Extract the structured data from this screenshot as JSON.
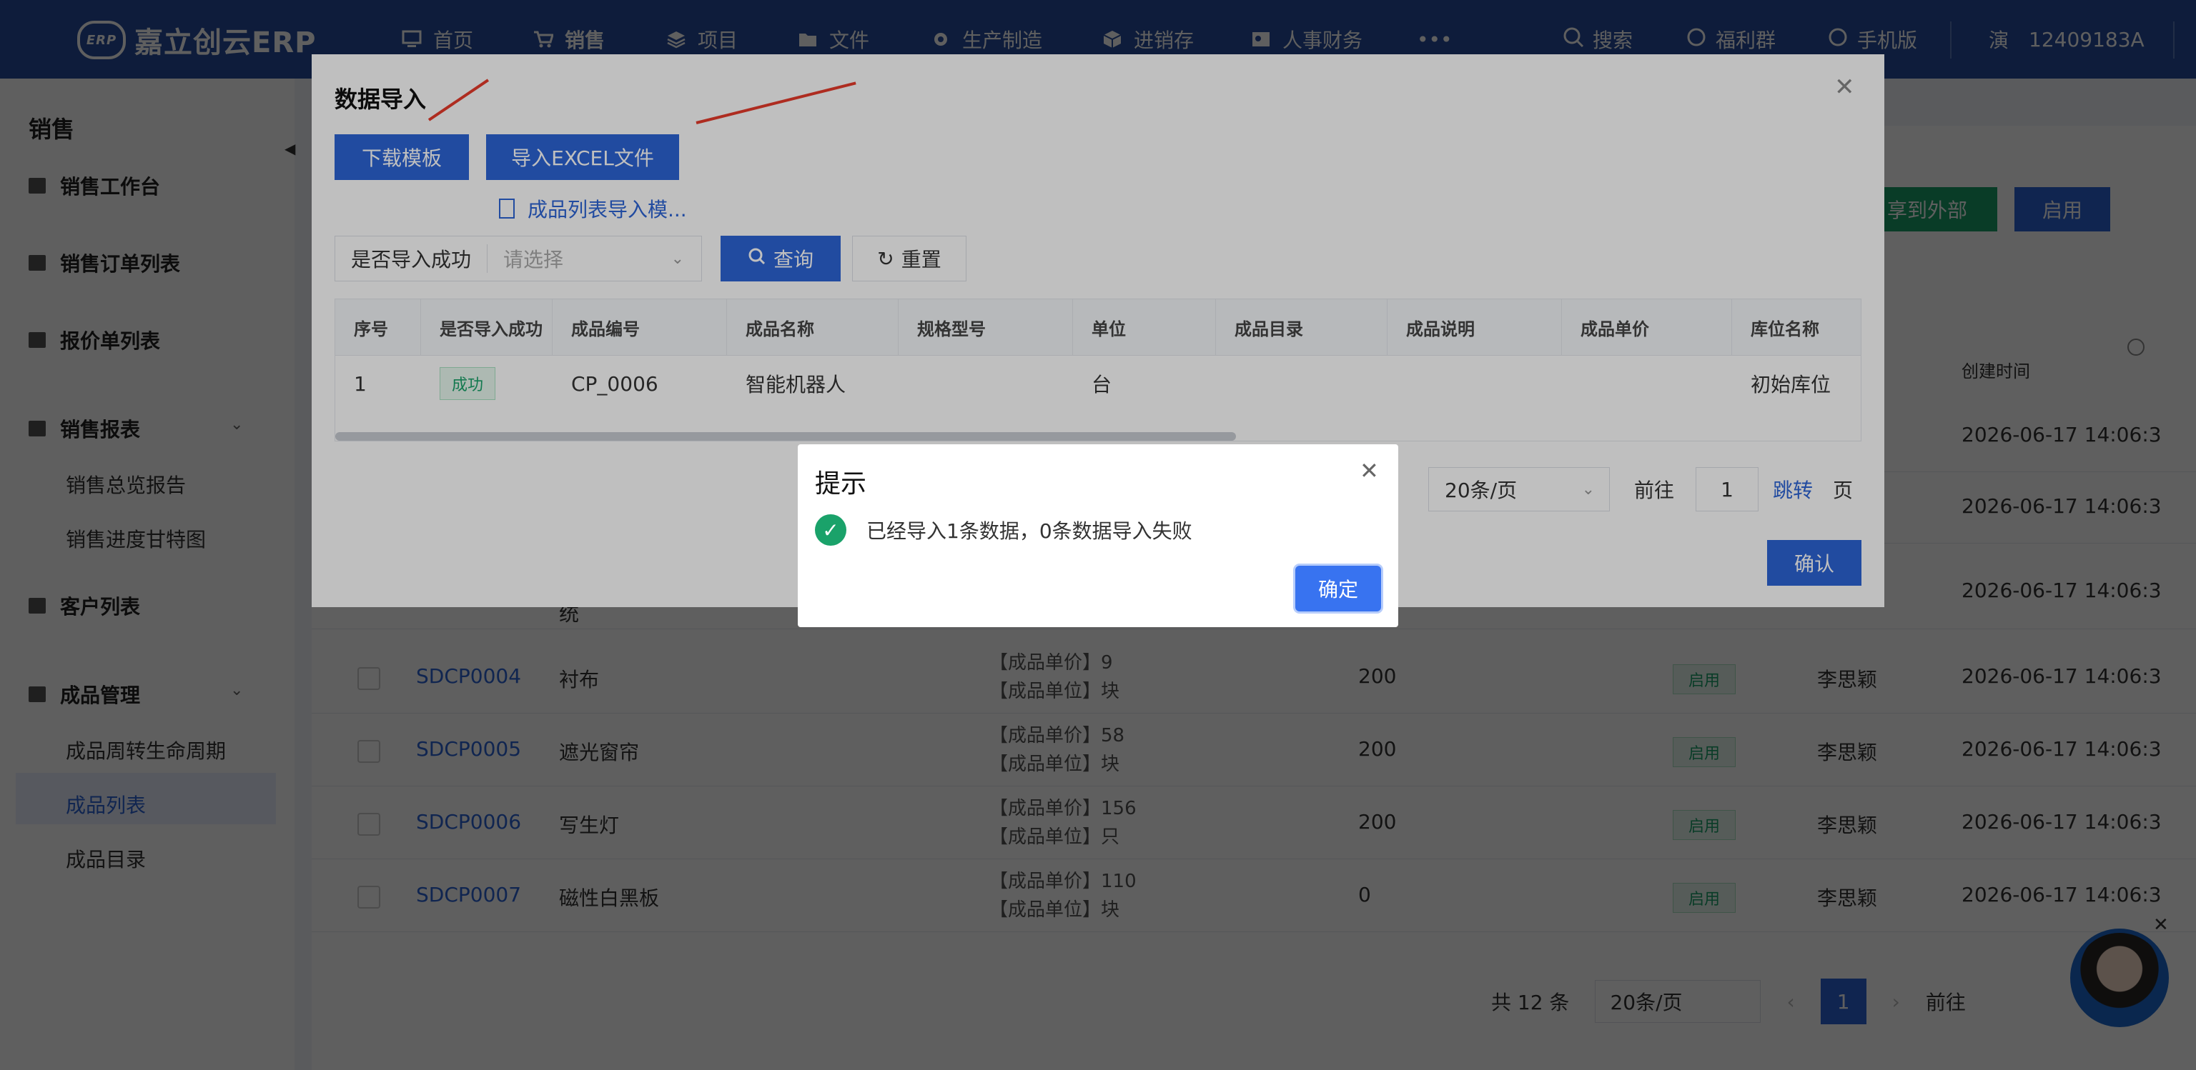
{
  "app": {
    "logo_text": "嘉立创云ERP",
    "logo_badge": "ERP"
  },
  "topnav": [
    {
      "label": "首页",
      "icon": "monitor-icon"
    },
    {
      "label": "销售",
      "icon": "cart-icon"
    },
    {
      "label": "项目",
      "icon": "layers-icon"
    },
    {
      "label": "文件",
      "icon": "folder-icon"
    },
    {
      "label": "生产制造",
      "icon": "gear-icon"
    },
    {
      "label": "进销存",
      "icon": "box-icon"
    },
    {
      "label": "人事财务",
      "icon": "id-card-icon"
    },
    {
      "label": "•••",
      "icon": "more-icon"
    }
  ],
  "rightnav": {
    "search": "搜索",
    "welfare": "福利群",
    "mobile": "手机版",
    "user_initial": "演",
    "account": "12409183A"
  },
  "sidebar": {
    "title": "销售",
    "items": [
      {
        "label": "销售工作台"
      },
      {
        "label": "销售订单列表"
      },
      {
        "label": "报价单列表"
      },
      {
        "label": "销售报表"
      },
      {
        "label": "销售总览报告"
      },
      {
        "label": "销售进度甘特图"
      },
      {
        "label": "客户列表"
      },
      {
        "label": "成品管理"
      },
      {
        "label": "成品周转生命周期"
      },
      {
        "label": "成品列表"
      },
      {
        "label": "成品目录"
      }
    ]
  },
  "main": {
    "share_button": "享到外部",
    "enable_button": "启用",
    "col_created": "创建时间",
    "rows": [
      {
        "code": "",
        "name": "",
        "price": "",
        "unit": "",
        "qty": "",
        "status": "",
        "owner": "",
        "created": "2026-06-17 14:06:3"
      },
      {
        "code": "",
        "name": "",
        "price": "",
        "unit": "",
        "qty": "",
        "status": "",
        "owner": "",
        "created": "2026-06-17 14:06:3"
      },
      {
        "code": "",
        "name": "统",
        "price": "",
        "unit": "",
        "qty": "",
        "status": "",
        "owner": "",
        "created": "2026-06-17 14:06:3"
      },
      {
        "code": "SDCP0004",
        "name": "衬布",
        "price": "【成品单价】9",
        "unit": "【成品单位】块",
        "qty": "200",
        "status": "启用",
        "owner": "李思颖",
        "created": "2026-06-17 14:06:3"
      },
      {
        "code": "SDCP0005",
        "name": "遮光窗帘",
        "price": "【成品单价】58",
        "unit": "【成品单位】块",
        "qty": "200",
        "status": "启用",
        "owner": "李思颖",
        "created": "2026-06-17 14:06:3"
      },
      {
        "code": "SDCP0006",
        "name": "写生灯",
        "price": "【成品单价】156",
        "unit": "【成品单位】只",
        "qty": "200",
        "status": "启用",
        "owner": "李思颖",
        "created": "2026-06-17 14:06:3"
      },
      {
        "code": "SDCP0007",
        "name": "磁性白黑板",
        "price": "【成品单价】110",
        "unit": "【成品单位】块",
        "qty": "0",
        "status": "启用",
        "owner": "李思颖",
        "created": "2026-06-17 14:06:3"
      }
    ],
    "pager": {
      "total": "共 12 条",
      "page_size": "20条/页",
      "current": "1",
      "goto": "前往"
    }
  },
  "import_dialog": {
    "title": "数据导入",
    "download_template": "下载模板",
    "import_excel": "导入EXCEL文件",
    "file_name": "成品列表导入模...",
    "filter_label": "是否导入成功",
    "filter_placeholder": "请选择",
    "query": "查询",
    "reset": "重置",
    "columns": [
      "序号",
      "是否导入成功",
      "成品编号",
      "成品名称",
      "规格型号",
      "单位",
      "成品目录",
      "成品说明",
      "成品单价",
      "库位名称"
    ],
    "rows": [
      {
        "index": "1",
        "status": "成功",
        "code": "CP_0006",
        "name": "智能机器人",
        "spec": "",
        "unit": "台",
        "catalog": "",
        "desc": "",
        "price": "",
        "location": "初始库位"
      }
    ],
    "pager": {
      "page_size": "20条/页",
      "goto": "前往",
      "page": "1",
      "jump": "跳转",
      "page_suffix": "页"
    },
    "confirm": "确认"
  },
  "prompt": {
    "title": "提示",
    "message": "已经导入1条数据，0条数据导入失败",
    "ok": "确定"
  },
  "colors": {
    "topbar": "#274c9e",
    "primary": "#2d64d6",
    "success": "#1aa26a",
    "arrow": "#e83b2b"
  }
}
